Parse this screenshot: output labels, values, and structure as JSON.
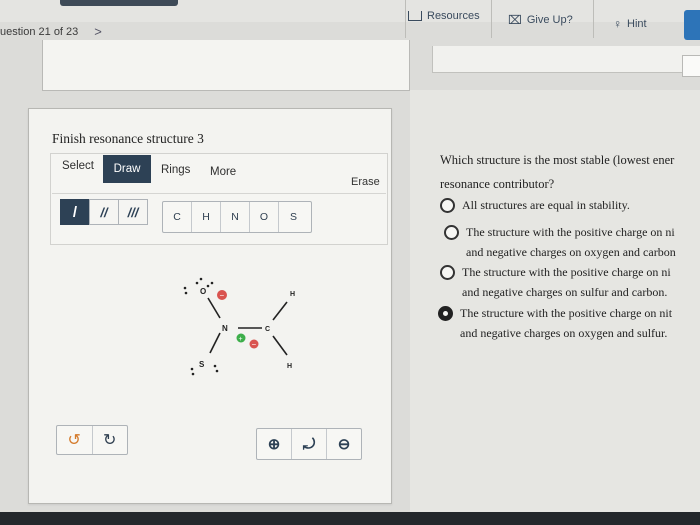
{
  "header": {
    "resources_label": "Resources",
    "giveup_label": "Give Up?",
    "hint_label": "Hint",
    "question_nav": "uestion 21 of 23",
    "next_chevron": ">"
  },
  "editor": {
    "title": "Finish resonance structure 3",
    "tabs": [
      "Select",
      "Draw",
      "Rings",
      "More"
    ],
    "active_tab": "Draw",
    "erase_label": "Erase",
    "bond_tools": [
      "/",
      "//",
      "///"
    ],
    "atoms": [
      "C",
      "H",
      "N",
      "O",
      "S"
    ],
    "molecule_labels": {
      "oxygen": "O",
      "sulfur": "S",
      "nitrogen": "N",
      "carbon": "C",
      "hydrogen_top": "H",
      "hydrogen_bottom": "H",
      "plus": "+",
      "minus": "−"
    },
    "undo_icon": "undo-icon",
    "redo_icon": "redo-icon",
    "zoom_in_icon": "zoom-in-icon",
    "reset_icon": "reset-view-icon",
    "zoom_out_icon": "zoom-out-icon"
  },
  "question": {
    "prompt_line1": "Which structure is the most stable (lowest ener",
    "prompt_line2": "resonance contributor?",
    "options": [
      {
        "line1": "All structures are equal in stability.",
        "line2": "",
        "selected": false
      },
      {
        "line1": "The structure with the positive charge on ni",
        "line2": "and negative charges on oxygen and carbon",
        "selected": false
      },
      {
        "line1": "The structure with the positive charge on ni",
        "line2": "and negative charges on sulfur and carbon.",
        "selected": false
      },
      {
        "line1": "The structure with the positive charge on nit",
        "line2": "and negative charges on oxygen and sulfur.",
        "selected": true
      }
    ]
  },
  "colors": {
    "toolbar_active": "#2d4155",
    "hint_blue": "#2d74b8",
    "negative_charge": "#d9534f",
    "positive_charge": "#3cae4a"
  }
}
